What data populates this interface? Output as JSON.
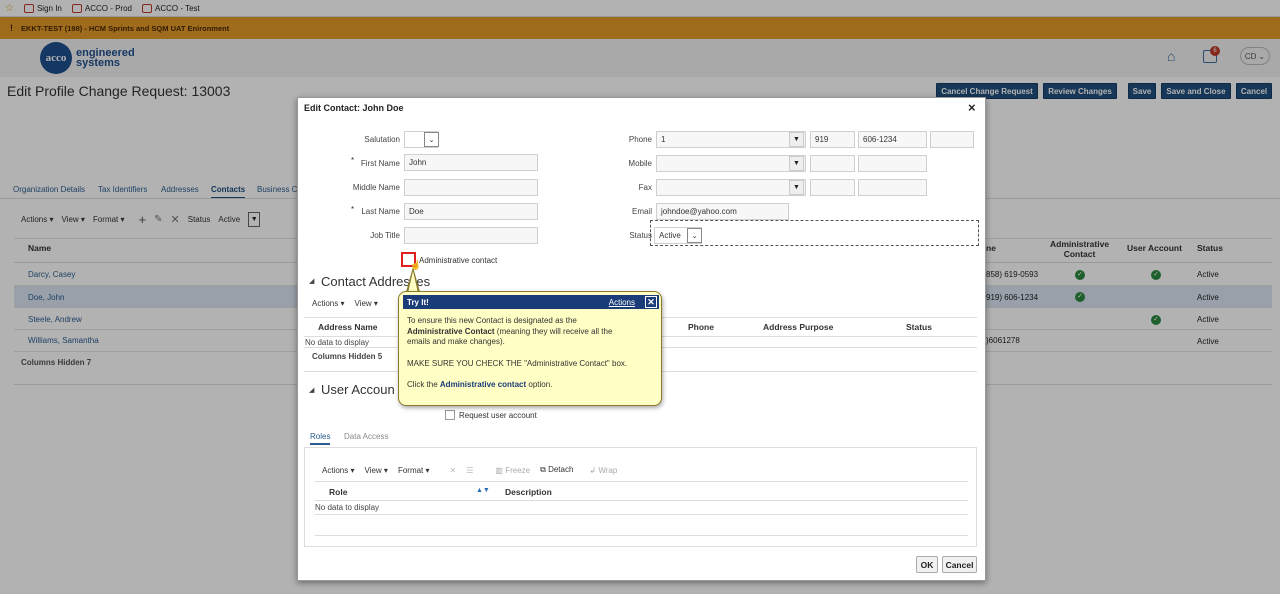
{
  "bookmarks": [
    {
      "label": "Sign In"
    },
    {
      "label": "ACCO - Prod"
    },
    {
      "label": "ACCO - Test"
    }
  ],
  "env_banner": "EKKT-TEST (198) - HCM Sprints and SQM UAT Enironment",
  "logo": {
    "mark": "acco",
    "line1": "engineered",
    "line2": "systems"
  },
  "header": {
    "notif_count": "6",
    "user_initials": "CD"
  },
  "page_title": "Edit Profile Change Request: 13003",
  "top_buttons": {
    "cancel_change": "Cancel Change Request",
    "review_changes": "Review Changes",
    "save": "Save",
    "save_close": "Save and Close",
    "cancel": "Cancel"
  },
  "tabs": [
    "Organization Details",
    "Tax Identifiers",
    "Addresses",
    "Contacts",
    "Business C"
  ],
  "toolbar": {
    "actions": "Actions",
    "view": "View",
    "format": "Format",
    "status_label": "Status",
    "status_value": "Active"
  },
  "contacts_table": {
    "headers": {
      "name": "Name",
      "phone": "ne",
      "admin_line1": "Administrative",
      "admin_line2": "Contact",
      "user_account": "User Account",
      "status": "Status"
    },
    "rows": [
      {
        "name": "Darcy, Casey",
        "phone": "858) 619-0593",
        "admin": true,
        "user": true,
        "status": "Active"
      },
      {
        "name": "Doe, John",
        "phone": "919) 606-1234",
        "admin": true,
        "user": false,
        "status": "Active"
      },
      {
        "name": "Steele, Andrew",
        "phone": "",
        "admin": false,
        "user": true,
        "status": "Active"
      },
      {
        "name": "Williams, Samantha",
        "phone": ")6061278",
        "admin": false,
        "user": false,
        "status": "Active"
      }
    ],
    "columns_hidden": "Columns Hidden  7"
  },
  "dialog": {
    "title": "Edit Contact: John Doe",
    "close_glyph": "×",
    "form": {
      "salutation_label": "Salutation",
      "first_name_label": "First Name",
      "first_name": "John",
      "middle_name_label": "Middle Name",
      "last_name_label": "Last Name",
      "last_name": "Doe",
      "job_title_label": "Job Title",
      "admin_contact_label": "Administrative contact",
      "phone_label": "Phone",
      "phone_country": "1",
      "phone_area": "919",
      "phone_number": "606-1234",
      "mobile_label": "Mobile",
      "fax_label": "Fax",
      "email_label": "Email",
      "email": "johndoe@yahoo.com",
      "status_label": "Status",
      "status": "Active"
    },
    "addresses": {
      "title": "Contact Addresses",
      "actions": "Actions",
      "view": "View",
      "headers": {
        "name": "Address Name",
        "phone": "Phone",
        "purpose": "Address Purpose",
        "status": "Status"
      },
      "empty": "No data to display",
      "columns_hidden": "Columns Hidden  5"
    },
    "user_account": {
      "title": "User Accoun",
      "request_label": "Request user account",
      "tabs": [
        "Roles",
        "Data Access"
      ],
      "toolbar": {
        "actions": "Actions",
        "view": "View",
        "format": "Format",
        "freeze": "Freeze",
        "detach": "Detach",
        "wrap": "Wrap"
      },
      "headers": {
        "role": "Role",
        "description": "Description"
      },
      "empty": "No data to display"
    },
    "ok": "OK",
    "cancel": "Cancel"
  },
  "callout": {
    "header": "Try It!",
    "actions_link": "Actions",
    "line1": "To ensure this new Contact is designated as the",
    "line2_bold": "Administrative Contact",
    "line2_rest": " (meaning they will receive all the",
    "line3": "emails and make changes).",
    "line4": "MAKE SURE YOU CHECK THE \"Administrative Contact\" box.",
    "line5_pre": "Click the ",
    "line5_bold": "Administrative contact",
    "line5_post": " option."
  },
  "colors": {
    "brand": "#214f7f",
    "env": "#e49a2a",
    "callout_bg": "#fffec4",
    "highlight": "#e02020"
  }
}
